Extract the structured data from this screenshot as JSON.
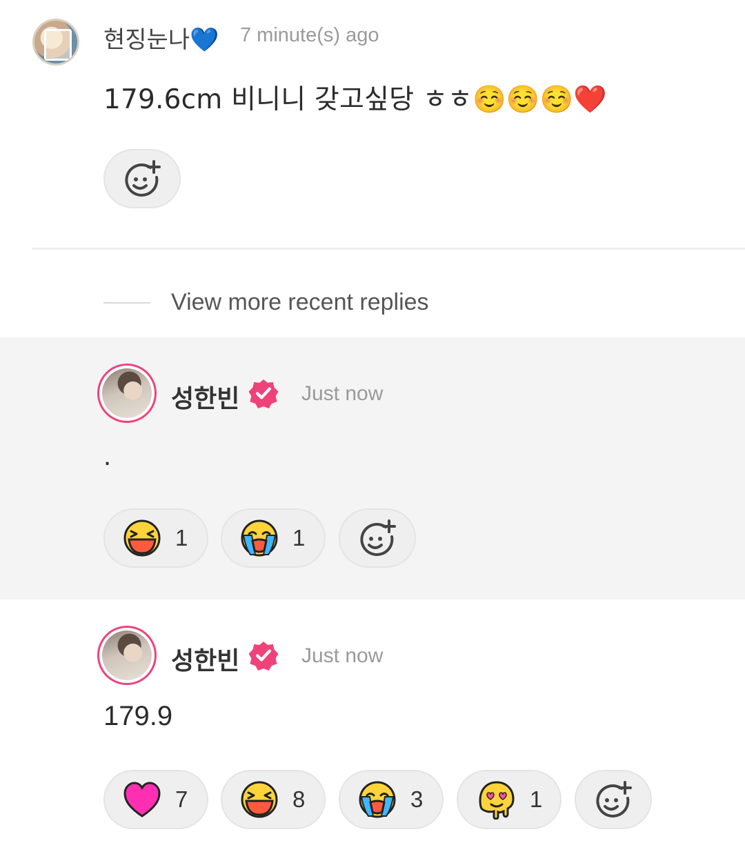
{
  "parent": {
    "username": "현징눈나💙",
    "time": "7 minute(s) ago",
    "text": "179.6cm 비니니 갖고싶당 ㅎㅎ☺️☺️☺️❤️"
  },
  "view_more": "View more recent replies",
  "replies": [
    {
      "username": "성한빈",
      "time": "Just now",
      "text": ".",
      "reactions": [
        {
          "icon": "laughing-emoji-icon",
          "count": "1"
        },
        {
          "icon": "crying-emoji-icon",
          "count": "1"
        }
      ]
    },
    {
      "username": "성한빈",
      "time": "Just now",
      "text": "179.9",
      "reactions": [
        {
          "icon": "heart-icon",
          "count": "7"
        },
        {
          "icon": "laughing-emoji-icon",
          "count": "8"
        },
        {
          "icon": "crying-emoji-icon",
          "count": "3"
        },
        {
          "icon": "melting-love-emoji-icon",
          "count": "1"
        }
      ]
    }
  ],
  "colors": {
    "verified": "#f0427a",
    "reply_highlight_bg": "#f4f4f4",
    "heart": "#ff2fb4"
  }
}
